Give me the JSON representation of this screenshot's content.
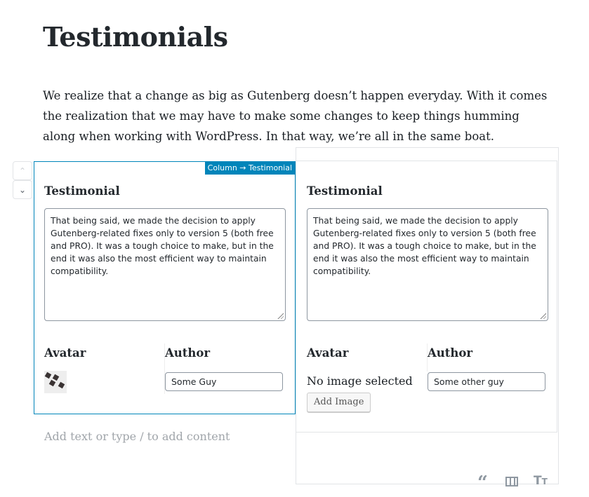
{
  "page": {
    "title": "Testimonials",
    "intro": "We realize that a change as big as Gutenberg doesn’t happen everyday. With it comes the realization that we may have to make some changes to keep things humming along when working with WordPress. In that way, we’re all in the same boat.",
    "placeholder": "Add text or type / to add content"
  },
  "movers": {
    "up_icon": "chevron-up-icon",
    "down_icon": "chevron-down-icon"
  },
  "breadcrumb": "Column → Testimonial",
  "columns": [
    {
      "heading": "Testimonial",
      "text": "That being said, we made the decision to apply Gutenberg-related fixes only to version 5 (both free and PRO). It was a tough choice to make, but in the end it was also the most efficient way to maintain compatibility.",
      "avatar_label": "Avatar",
      "author_label": "Author",
      "author_value": "Some Guy"
    },
    {
      "heading": "Testimonial",
      "text": "That being said, we made the decision to apply Gutenberg-related fixes only to version 5 (both free and PRO). It was a tough choice to make, but in the end it was also the most efficient way to maintain compatibility.",
      "avatar_label": "Avatar",
      "author_label": "Author",
      "no_image": "No image selected",
      "add_image": "Add Image",
      "author_value": "Some other guy"
    }
  ],
  "inserter_icons": [
    "quote-icon",
    "columns-icon",
    "heading-icon"
  ],
  "colors": {
    "accent": "#0085ba"
  }
}
